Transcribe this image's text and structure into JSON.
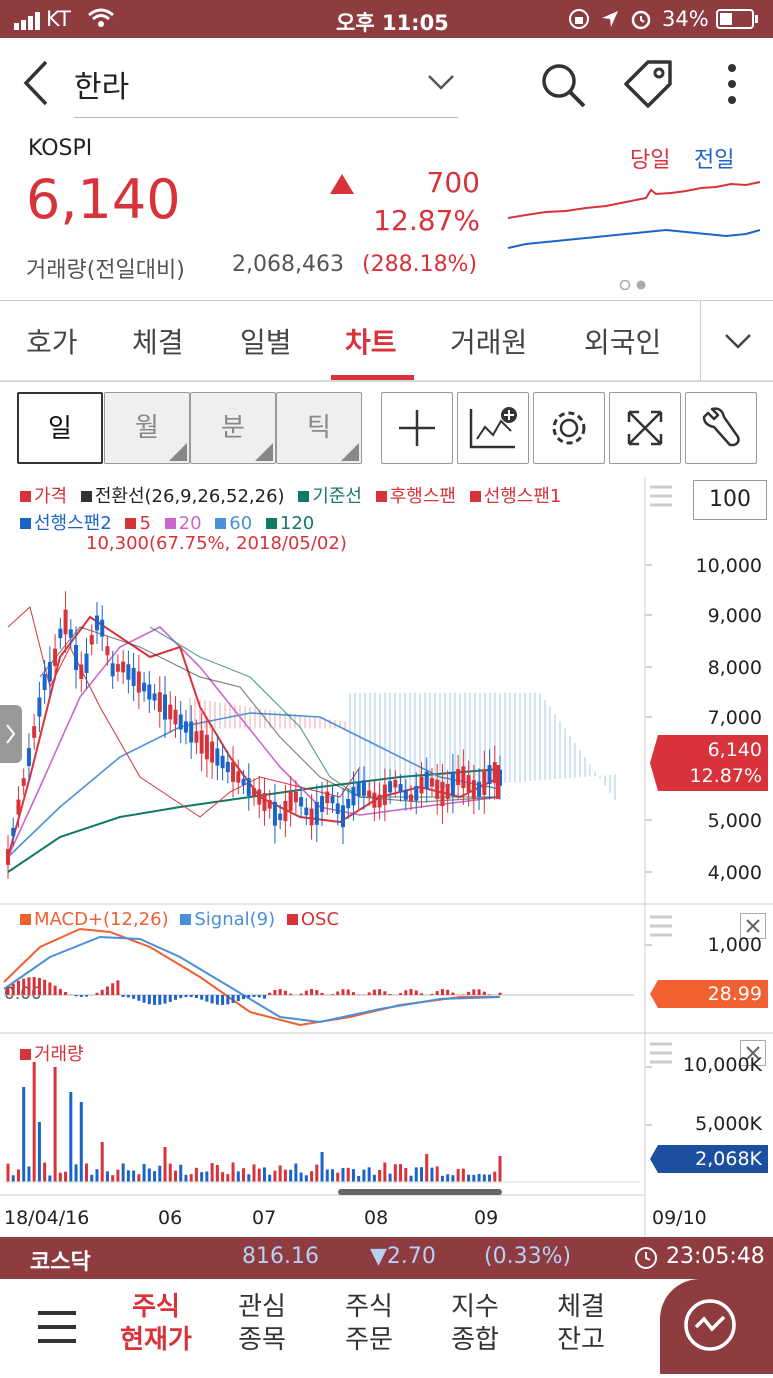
{
  "status": {
    "carrier": "KT",
    "time": "오후 11:05",
    "battery": "34%"
  },
  "header": {
    "title": "한라"
  },
  "quote": {
    "market": "KOSPI",
    "price": "6,140",
    "change": "700",
    "change_pct": "12.87%",
    "volume_label": "거래량(전일대비)",
    "volume": "2,068,463",
    "volume_pct": "(288.18%)",
    "legend_today": "당일",
    "legend_prev": "전일"
  },
  "tabs": [
    "호가",
    "체결",
    "일별",
    "차트",
    "거래원",
    "외국인"
  ],
  "period_buttons": [
    "일",
    "월",
    "분",
    "틱"
  ],
  "chart": {
    "count_input": "100",
    "legend_row1": [
      "가격",
      "전환선(26,9,26,52,26)",
      "기준선",
      "후행스팬",
      "선행스팬1"
    ],
    "legend_row2": [
      "선행스팬2",
      "5",
      "20",
      "60",
      "120"
    ],
    "high_annotation": "10,300(67.75%, 2018/05/02)",
    "price_axis": [
      "10,000",
      "9,000",
      "8,000",
      "7,000",
      "5,000",
      "4,000"
    ],
    "price_tag": "6,140",
    "price_tag_pct": "12.87%",
    "macd_legend": [
      "MACD+(12,26)",
      "Signal(9)",
      "OSC"
    ],
    "macd_axis": [
      "1,000"
    ],
    "macd_zero": "0.00",
    "macd_tag": "28.99",
    "vol_legend": "거래량",
    "vol_axis": [
      "10,000K",
      "5,000K"
    ],
    "vol_tag": "2,068K",
    "x_labels": [
      "18/04/16",
      "06",
      "07",
      "08",
      "09",
      "09/10"
    ]
  },
  "kosdaq": {
    "name": "코스닥",
    "value": "816.16",
    "change": "▼2.70",
    "pct": "(0.33%)",
    "time": "23:05:48"
  },
  "nav": [
    {
      "l1": "주식",
      "l2": "현재가"
    },
    {
      "l1": "관심",
      "l2": "종목"
    },
    {
      "l1": "주식",
      "l2": "주문"
    },
    {
      "l1": "지수",
      "l2": "종합"
    },
    {
      "l1": "체결",
      "l2": "잔고"
    }
  ],
  "colors": {
    "brand": "#8e3c3f",
    "up": "#d8323a",
    "down": "#1c64c8",
    "kijun": "#117a65",
    "ma20": "#cc66cc",
    "ma60": "#4a90d9"
  }
}
